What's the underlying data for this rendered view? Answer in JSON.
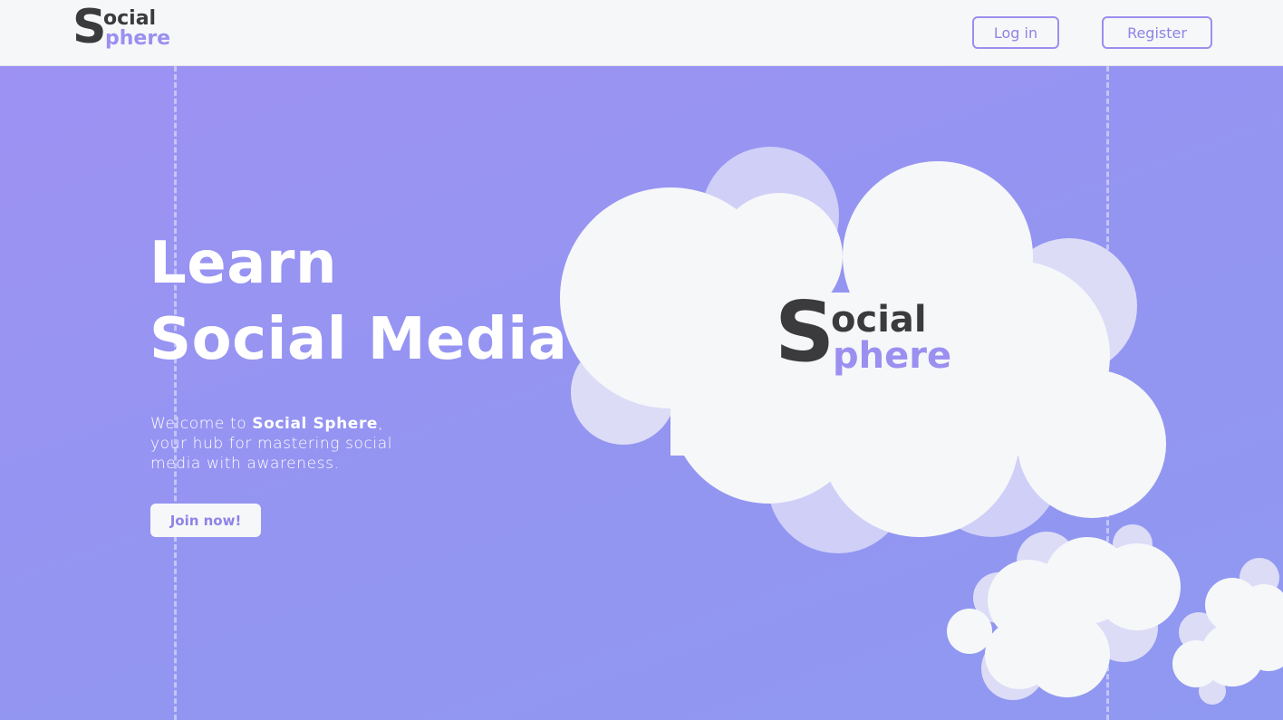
{
  "header": {
    "logo": {
      "s": "S",
      "ocial": "ocial",
      "phere": "phere"
    },
    "login_label": "Log in",
    "register_label": "Register"
  },
  "hero": {
    "headline_line1": "Learn",
    "headline_line2": "Social Media",
    "intro_prefix": "Welcome to ",
    "intro_brand": "Social Sphere",
    "intro_suffix": ", your hub for mastering social media with awareness.",
    "join_label": "Join now!",
    "cloud_logo": {
      "s": "S",
      "ocial": "ocial",
      "phere": "phere"
    }
  },
  "colors": {
    "accent": "#9b8ff0",
    "hero_background": "#9595f2",
    "cloud_white": "#f6f7f9",
    "cloud_shadow": "#dcdcf7",
    "logo_dark": "#3b3b3d"
  }
}
